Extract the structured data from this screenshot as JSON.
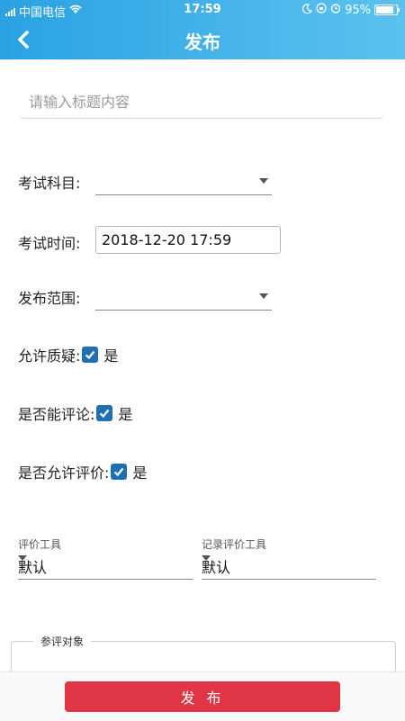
{
  "status_bar": {
    "carrier": "中国电信",
    "time": "17:59",
    "battery_percent": "95%",
    "battery_level": 0.95
  },
  "header": {
    "title": "发布",
    "back_icon": "chevron-left-icon"
  },
  "form": {
    "title_placeholder": "请输入标题内容",
    "subject_label": "考试科目:",
    "subject_value": "",
    "time_label": "考试时间:",
    "time_value": "2018-12-20 17:59",
    "scope_label": "发布范围:",
    "scope_value": "",
    "allow_query_label": "允许质疑:",
    "allow_query_option": "是",
    "can_comment_label": "是否能评论:",
    "can_comment_option": "是",
    "allow_eval_label": "是否允许评价:",
    "allow_eval_option": "是",
    "eval_tool_label": "评价工具",
    "eval_tool_value": "默认",
    "record_tool_label": "记录评价工具",
    "record_tool_value": "默认",
    "participants_legend": "参评对象"
  },
  "footer": {
    "publish_label": "发 布"
  },
  "colors": {
    "header_gradient_start": "#2aa2e3",
    "header_gradient_end": "#5bc2ef",
    "checkbox": "#1e6fb4",
    "publish_button": "#e03545"
  }
}
